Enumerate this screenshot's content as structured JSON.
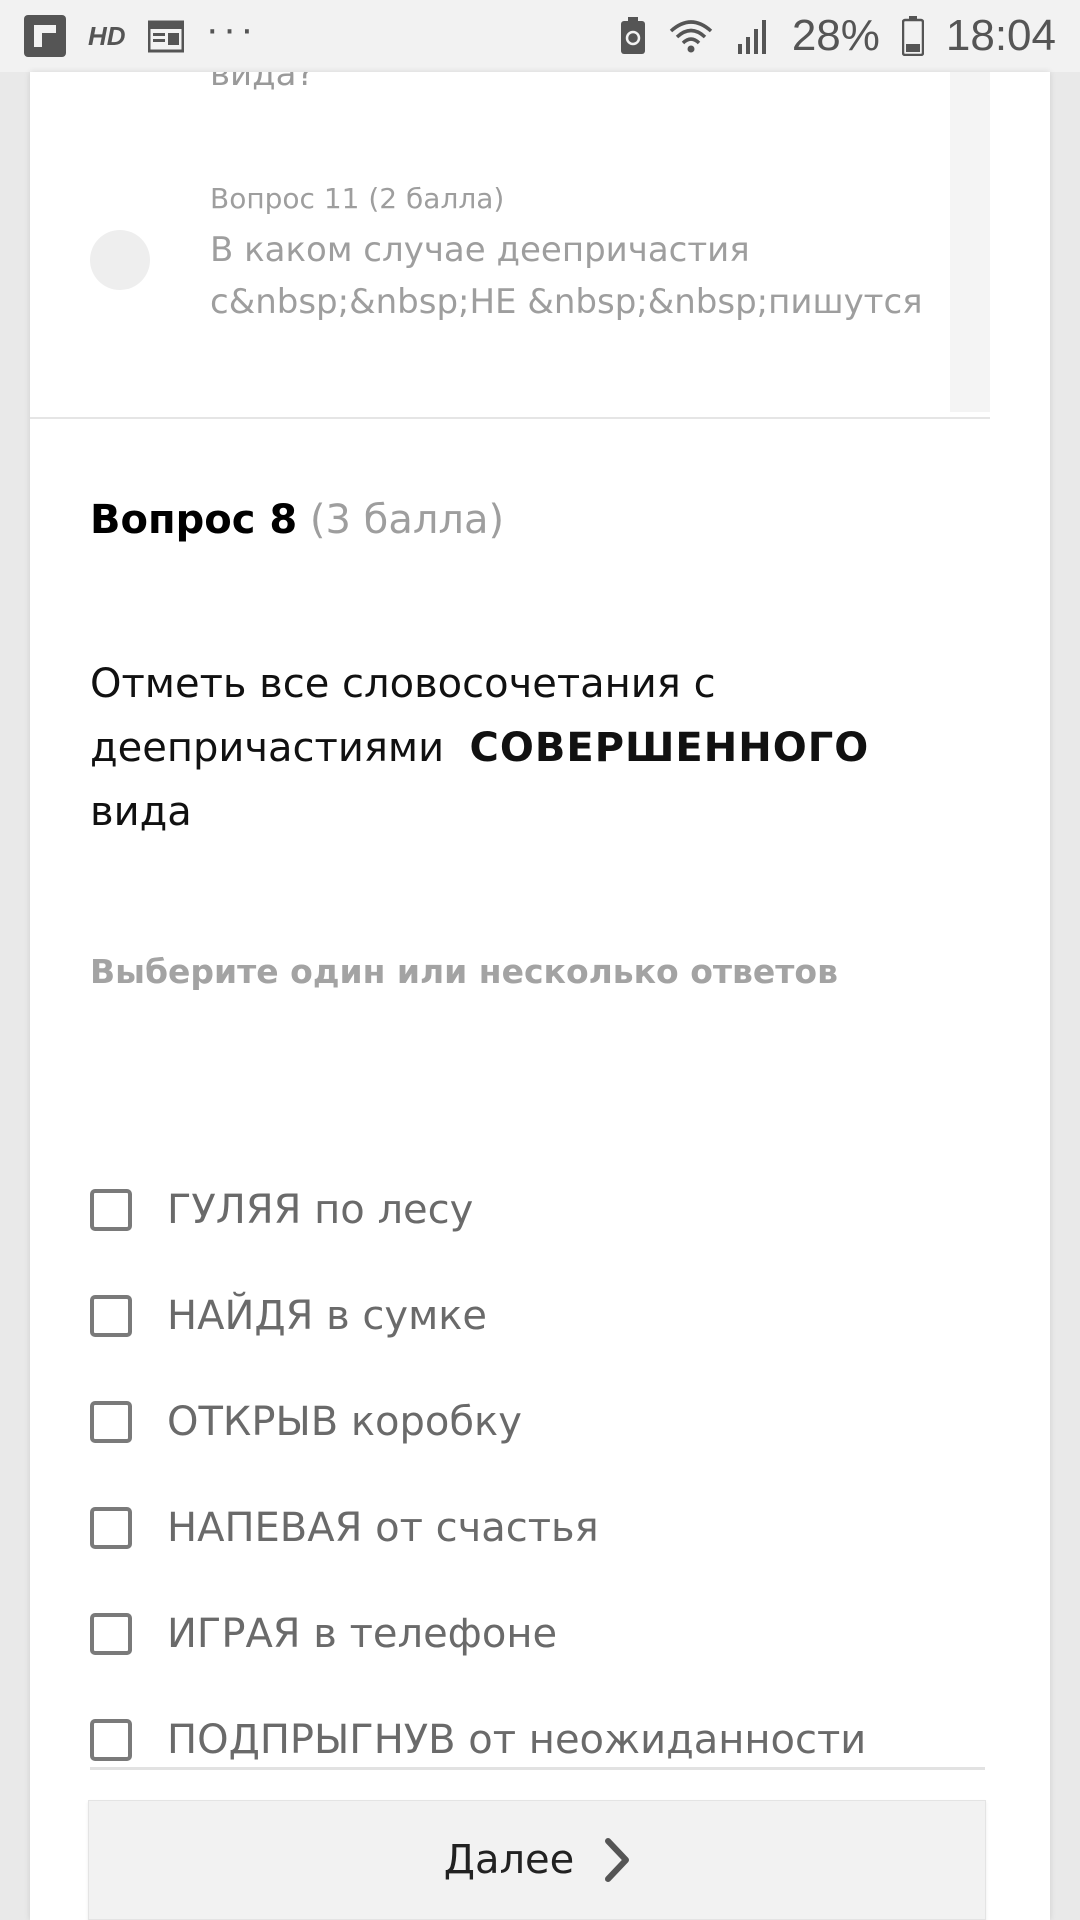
{
  "status_bar": {
    "battery_percent": "28%",
    "time": "18:04",
    "hd_label": "HD",
    "more_dots": "···"
  },
  "question_nav": {
    "prev_question_tail": "вида?",
    "item": {
      "meta": "Вопрос 11 (2 балла)",
      "text": "В каком случае деепричастия с&nbsp;&nbsp;НЕ &nbsp;&nbsp;пишутся"
    }
  },
  "question": {
    "number_label": "Вопрос 8",
    "points_label": "(3 балла)",
    "text_part1": "Отметь все словосочетания с деепричастиями",
    "text_emphasis": "СОВЕРШЕННОГО",
    "text_part2": "вида",
    "hint": "Выберите один или несколько ответов",
    "options": [
      {
        "label": "ГУЛЯЯ по лесу",
        "checked": false
      },
      {
        "label": "НАЙДЯ в сумке",
        "checked": false
      },
      {
        "label": "ОТКРЫВ коробку",
        "checked": false
      },
      {
        "label": "НАПЕВАЯ от счастья",
        "checked": false
      },
      {
        "label": "ИГРАЯ в телефоне",
        "checked": false
      },
      {
        "label": "ПОДПРЫГНУВ от неожиданности",
        "checked": false
      }
    ]
  },
  "footer": {
    "next_label": "Далее"
  },
  "colors": {
    "accent_text": "#000000",
    "muted": "#9e9e9e",
    "button_bg": "#f2f2f2"
  }
}
